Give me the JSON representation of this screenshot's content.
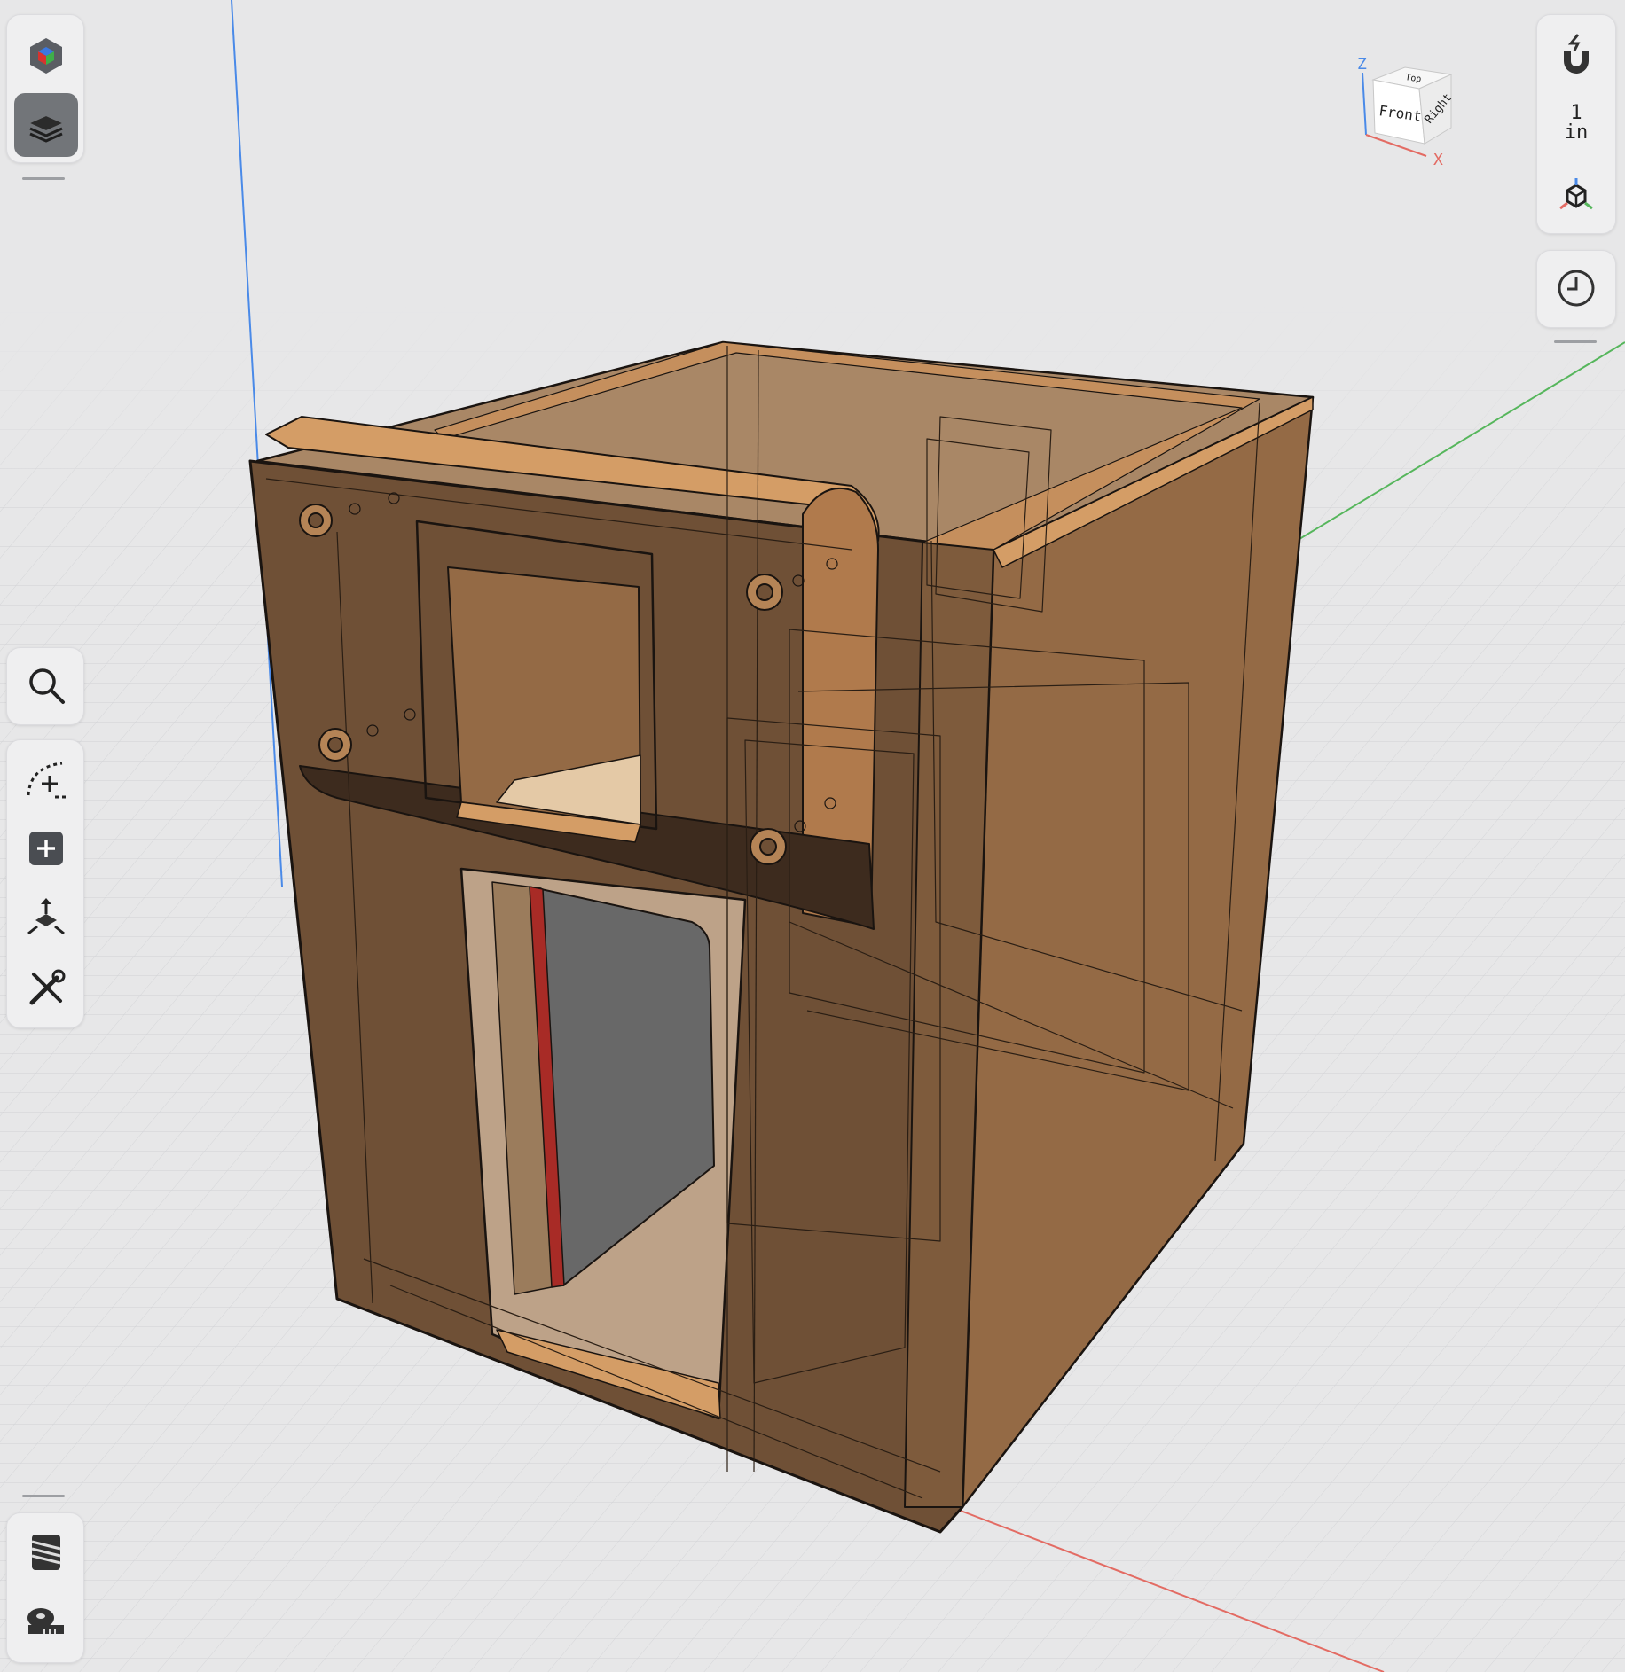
{
  "app": {
    "left_toolbar": {
      "top_group": [
        {
          "name": "appearance",
          "icon": "color-cube-icon",
          "active": false
        },
        {
          "name": "layers",
          "icon": "layers-icon",
          "active": true
        }
      ],
      "middle_group": [
        {
          "name": "search",
          "icon": "search-icon"
        }
      ],
      "tools_group": [
        {
          "name": "sketch",
          "icon": "sketch-arc-icon"
        },
        {
          "name": "add",
          "icon": "add-square-icon"
        },
        {
          "name": "transform",
          "icon": "transform-move-icon"
        },
        {
          "name": "tools",
          "icon": "wrench-screwdriver-icon"
        }
      ],
      "bottom_group": [
        {
          "name": "thread",
          "icon": "thread-icon"
        },
        {
          "name": "measure",
          "icon": "tape-measure-icon"
        }
      ]
    },
    "right_toolbar": {
      "snap_icon": "magnet-snap-icon",
      "scale_value": "1",
      "scale_unit": "in",
      "view_icon": "projection-cube-icon",
      "history_icon": "history-clock-icon"
    },
    "view_cube": {
      "top": "Top",
      "front": "Front",
      "right": "Right",
      "axis_z": "Z",
      "axis_x": "X"
    },
    "colors": {
      "background": "#e7e7e8",
      "grid_line": "#d2d3d6",
      "axis_x": "#e36b63",
      "axis_y": "#56b65c",
      "axis_z": "#4a8ae8",
      "body_dark": "#6f5036",
      "body_mid": "#946a45",
      "body_top": "#a98766",
      "body_edge": "#d49d66",
      "inner_tan": "#c9a481",
      "screen_gray": "#686868",
      "screen_red": "#a82b26"
    }
  }
}
